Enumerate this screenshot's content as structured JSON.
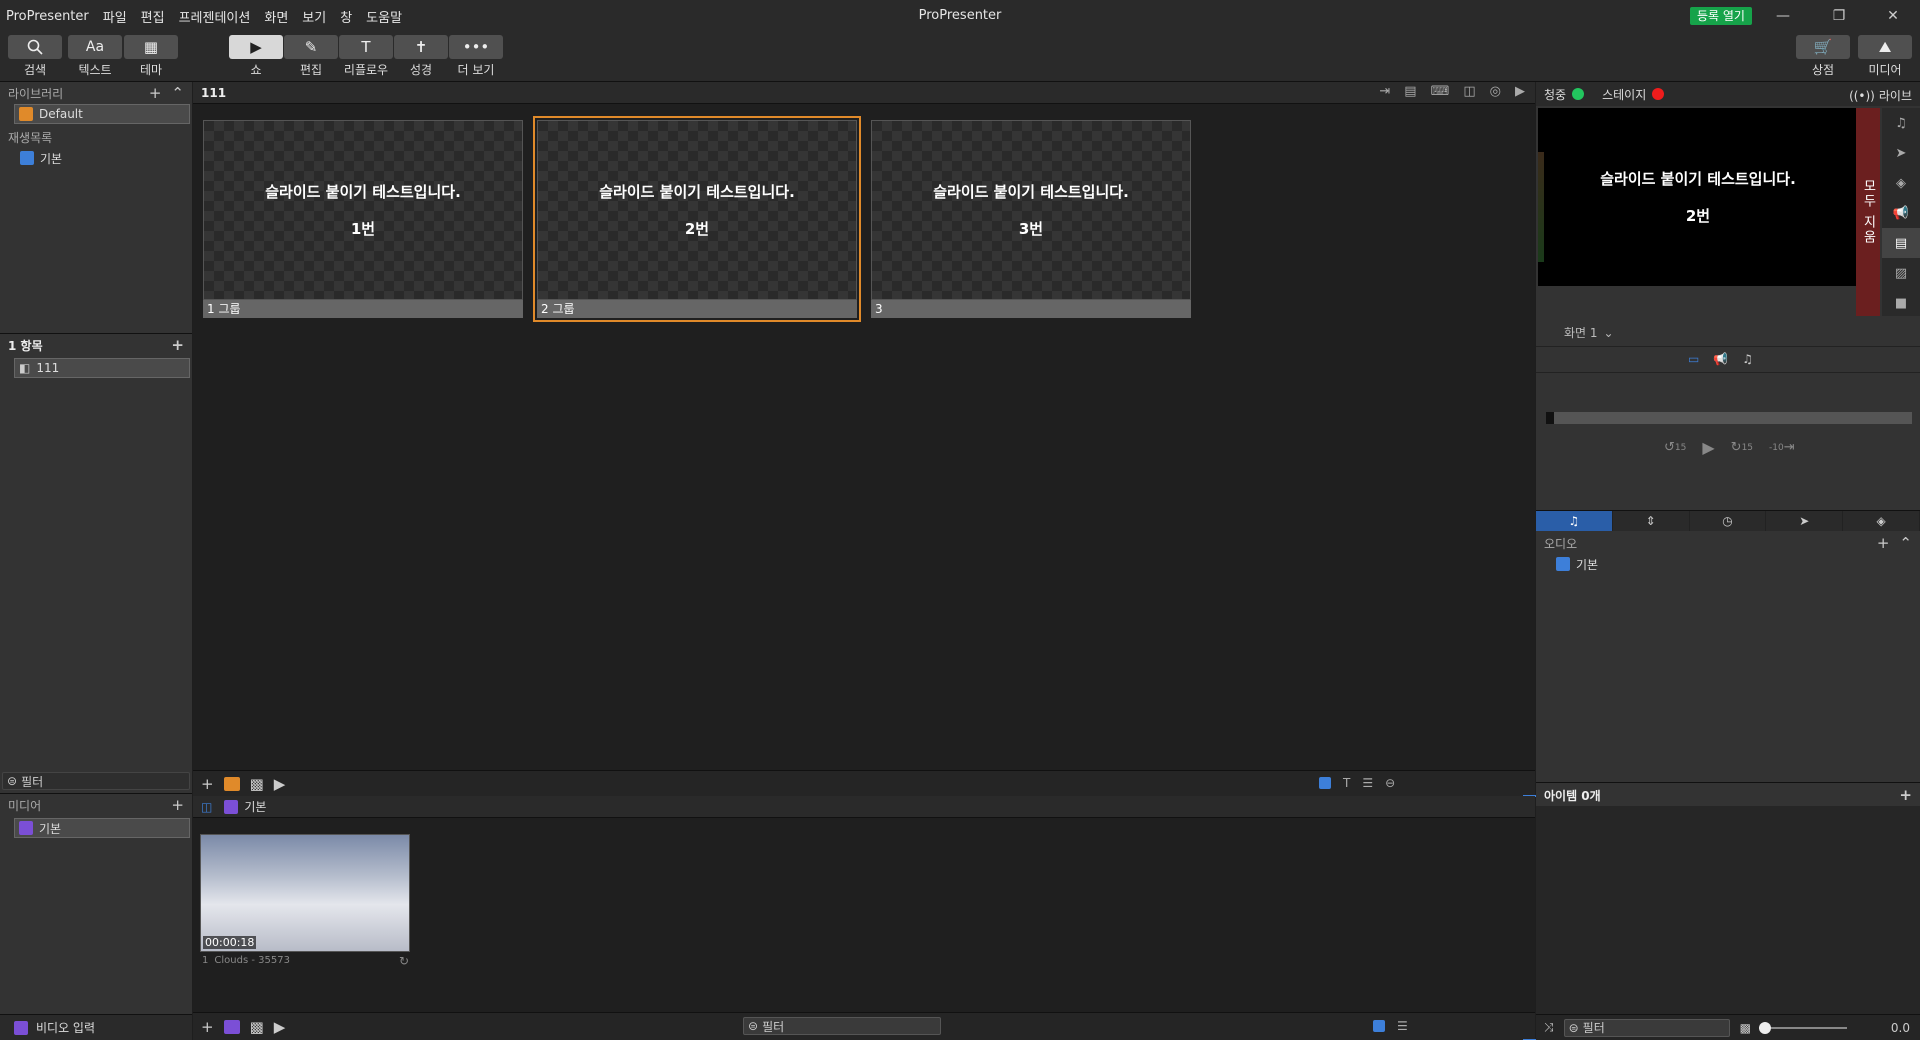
{
  "window": {
    "title": "ProPresenter",
    "register_label": "등록 열기"
  },
  "menu": [
    "ProPresenter",
    "파일",
    "편집",
    "프레젠테이션",
    "화면",
    "보기",
    "창",
    "도움말"
  ],
  "toolbar": {
    "search": "검색",
    "text": "텍스트",
    "theme": "테마",
    "show": "쇼",
    "edit": "편집",
    "reflow": "리플로우",
    "bible": "성경",
    "more": "더 보기",
    "store": "상점",
    "media": "미디어"
  },
  "library": {
    "header": "라이브러리",
    "default_item": "Default",
    "playlist_header": "재생목록",
    "playlist_item": "기본",
    "items_header": "1 항목",
    "presentation": "111",
    "filter": "필터"
  },
  "media_bin": {
    "header": "미디어",
    "item": "기본",
    "video_input": "비디오 입력"
  },
  "presentation": {
    "title": "111",
    "slides": [
      {
        "line1": "슬라이드 붙이기 테스트입니다.",
        "line2": "1번",
        "caption": "1 그룹",
        "active": false
      },
      {
        "line1": "슬라이드 붙이기 테스트입니다.",
        "line2": "2번",
        "caption": "2 그룹",
        "active": true
      },
      {
        "line1": "슬라이드 붙이기 테스트입니다.",
        "line2": "3번",
        "caption": "3",
        "active": false
      }
    ]
  },
  "media_panel": {
    "playlist": "기본",
    "clip": {
      "duration": "00:00:18",
      "index": "1",
      "name": "Clouds - 35573"
    },
    "filter": "필터"
  },
  "live": {
    "audience": "청중",
    "stage": "스테이지",
    "live_label": "라이브",
    "clear_all": "모두 지움",
    "preview_line1": "슬라이드 붙이기 테스트입니다.",
    "preview_line2": "2번",
    "screen": "화면 1",
    "transport": {
      "back": "15",
      "forward": "15",
      "skip": "-10"
    }
  },
  "audio": {
    "header": "오디오",
    "item": "기본"
  },
  "items": {
    "header": "아이템 0개",
    "filter": "필터",
    "value": "0.0"
  },
  "colors": {
    "accent": "#e08a2a",
    "live_green": "#22c55e",
    "stage_red": "#ef1c1c",
    "clear_red": "#6b1f1f",
    "blue": "#2a5ea8"
  }
}
